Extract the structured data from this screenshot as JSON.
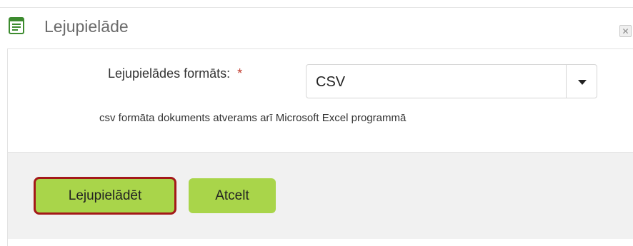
{
  "dialog": {
    "title": "Lejupielāde",
    "title_icon": "form-icon",
    "close_icon": "close-icon",
    "close_glyph": "✕"
  },
  "form": {
    "format_label": "Lejupielādes formāts:",
    "required_mark": "*",
    "format_value": "CSV",
    "hint": "csv formāta dokuments atverams arī Microsoft Excel programmā"
  },
  "buttons": {
    "download": "Lejupielādēt",
    "cancel": "Atcelt"
  },
  "colors": {
    "button_green": "#a9d54a",
    "highlight_border": "#a31919",
    "required": "#c0392b"
  }
}
